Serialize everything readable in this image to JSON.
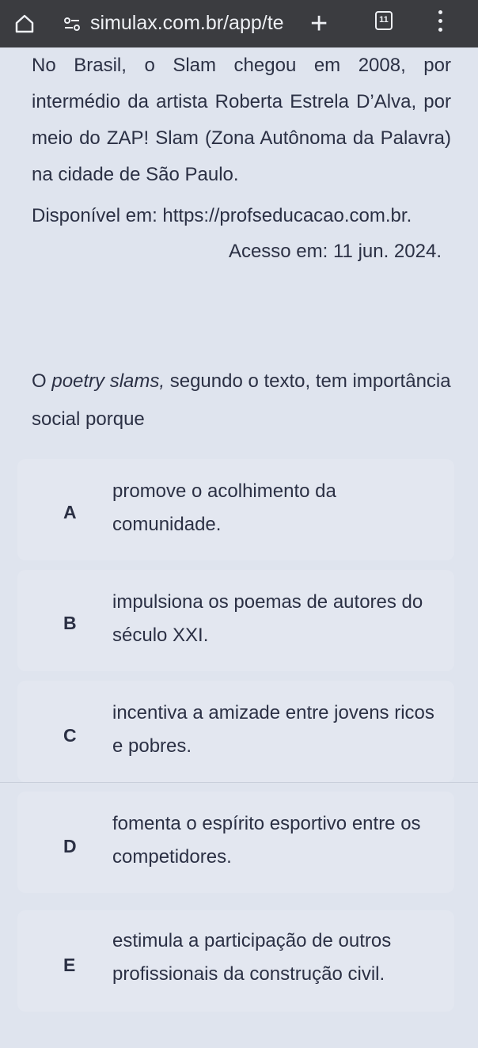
{
  "browser": {
    "url": "simulax.com.br/app/te",
    "tab_count": "11",
    "icons": [
      "home-icon",
      "tune-icon",
      "plus-icon",
      "tabs-icon",
      "menu-icon"
    ]
  },
  "text": {
    "paragraph": "No Brasil, o Slam chegou em 2008, por intermédio da artista Roberta Estrela D’Alva, por meio do ZAP! Slam (Zona Autônoma da Palavra) na cidade de São Paulo.",
    "source": "Disponível em: https://profseducacao.com.br.",
    "access": "Acesso em: 11 jun. 2024."
  },
  "question": {
    "prefix": "O ",
    "emphasis": "poetry slams,",
    "suffix": " segundo o texto, tem importância social porque"
  },
  "options": [
    {
      "letter": "A",
      "text": "promove o acolhimento da comunidade."
    },
    {
      "letter": "B",
      "text": "impulsiona os poemas de autores do século XXI."
    },
    {
      "letter": "C",
      "text": "incentiva a amizade entre jovens ricos e pobres."
    },
    {
      "letter": "D",
      "text": "fomenta o espírito esportivo entre os competidores."
    },
    {
      "letter": "E",
      "text": "estimula a participação de outros profissionais da construção civil."
    }
  ]
}
